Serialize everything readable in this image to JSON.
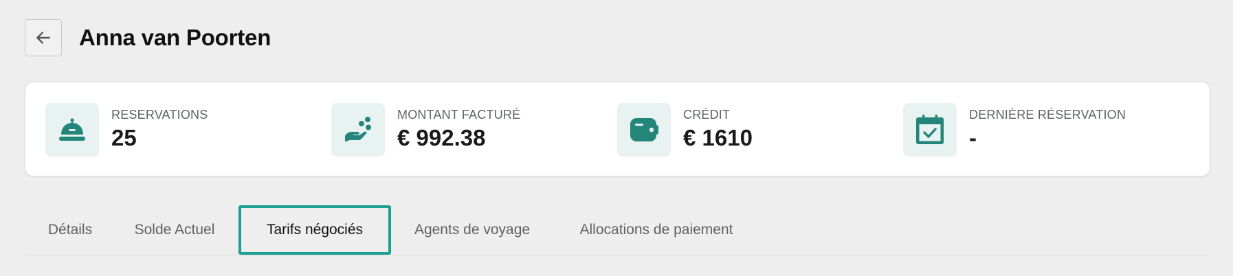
{
  "header": {
    "back_label": "Back",
    "title": "Anna van Poorten"
  },
  "stats": [
    {
      "icon": "concierge-bell-icon",
      "label": "RESERVATIONS",
      "value": "25"
    },
    {
      "icon": "hand-coins-icon",
      "label": "MONTANT FACTURÉ",
      "value": "€ 992.38"
    },
    {
      "icon": "wallet-icon",
      "label": "CRÉDIT",
      "value": "€ 1610"
    },
    {
      "icon": "calendar-check-icon",
      "label": "DERNIÈRE RÉSERVATION",
      "value": "-"
    }
  ],
  "tabs": [
    {
      "label": "Détails",
      "active": false
    },
    {
      "label": "Solde Actuel",
      "active": false
    },
    {
      "label": "Tarifs négociés",
      "active": true
    },
    {
      "label": "Agents de voyage",
      "active": false
    },
    {
      "label": "Allocations de paiement",
      "active": false
    }
  ],
  "colors": {
    "accent": "#1ba091",
    "icon": "#24857b",
    "icon_bg": "#e7f2f1",
    "page_bg": "#eeeeee"
  }
}
